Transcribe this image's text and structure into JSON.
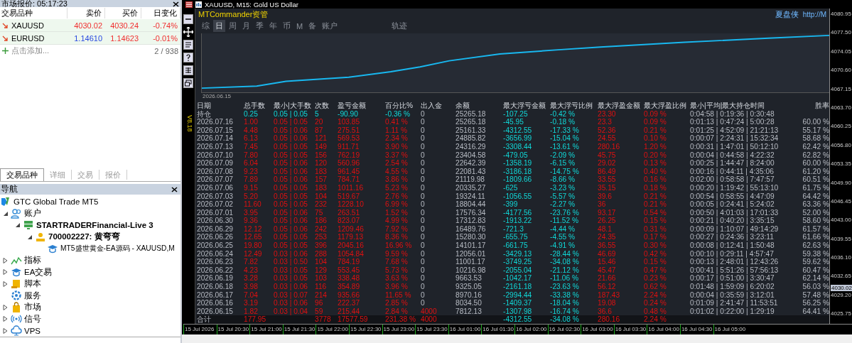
{
  "market_watch": {
    "title": "市场报价: 05:17:23",
    "columns": [
      "交易品种",
      "卖价",
      "买价",
      "日变化"
    ],
    "rows": [
      {
        "symbol": "XAUUSD",
        "bid": "4030.02",
        "ask": "4030.24",
        "change": "-0.74%",
        "color": "#f03030"
      },
      {
        "symbol": "EURUSD",
        "bid": "1.14610",
        "ask": "1.14623",
        "change": "-0.01%",
        "color": "#2848e0"
      }
    ],
    "add_label": "点击添加...",
    "count": "2 / 938"
  },
  "left_tabs": [
    {
      "label": "交易品种",
      "selected": true
    },
    {
      "label": "详细",
      "selected": false
    },
    {
      "label": "交易",
      "selected": false
    },
    {
      "label": "报价",
      "selected": false
    }
  ],
  "navigator": {
    "title": "导航",
    "tree": [
      {
        "label": "GTC Global Trade MT5",
        "kind": "broker",
        "children": [
          {
            "label": "账户",
            "kind": "accounts",
            "expanded": true,
            "children": [
              {
                "label": "STARTRADERFinancial-Live 3",
                "kind": "server",
                "expanded": true,
                "children": [
                  {
                    "label": "700002227: 黄弯弯",
                    "kind": "account",
                    "expanded": true,
                    "children": [
                      {
                        "label": "MT5盛世黄金-EA源码 - XAUUSD,M",
                        "kind": "expert"
                      }
                    ]
                  }
                ]
              }
            ]
          },
          {
            "label": "指标",
            "kind": "indicators",
            "expanded": false
          },
          {
            "label": "EA交易",
            "kind": "experts",
            "expanded": false
          },
          {
            "label": "脚本",
            "kind": "scripts",
            "expanded": false
          },
          {
            "label": "服务",
            "kind": "services"
          },
          {
            "label": "市场",
            "kind": "market",
            "expanded": false
          },
          {
            "label": "信号",
            "kind": "signals",
            "expanded": false
          },
          {
            "label": "VPS",
            "kind": "vps",
            "expanded": false
          }
        ]
      }
    ]
  },
  "chart": {
    "title": "XAUUSD, M15:  Gold US Dollar",
    "version": "V8.18",
    "panel": {
      "title": "MTCommander资管",
      "brand": "夏盘侠",
      "link": "http://M",
      "tabs": [
        {
          "label": "综",
          "selected": false
        },
        {
          "label": "日",
          "selected": true
        },
        {
          "label": "周",
          "selected": false
        },
        {
          "label": "月",
          "selected": false
        },
        {
          "label": "季",
          "selected": false
        },
        {
          "label": "年",
          "selected": false
        },
        {
          "label": "币",
          "selected": false
        },
        {
          "label": "M",
          "selected": false
        },
        {
          "label": "备",
          "selected": false
        },
        {
          "label": "账户",
          "selected": false
        },
        {
          "label": "轨迹",
          "selected": false
        }
      ],
      "equity_start": "2026.06.15",
      "table": {
        "columns": [
          "日期",
          "总手数",
          "最小|大手数",
          "次数",
          "盈亏金额",
          "百分比%",
          "出入金",
          "余额",
          "最大浮亏金额",
          "最大浮亏比例",
          "最大浮盈金额",
          "最大浮盈比例",
          "最小|平均|最大持仓时间",
          "胜率"
        ],
        "rows": [
          {
            "kind": "hold",
            "cells": [
              "持仓",
              "0.25",
              "0.05 | 0.05",
              "5",
              "-90.90",
              "-0.36 %",
              "0",
              "25265.18",
              "-107.25",
              "-0.42 %",
              "23.30",
              "0.09 %",
              "0:04:58 | 0:19:36 | 0:30:48",
              null
            ]
          },
          {
            "kind": "day",
            "cells": [
              "2026.07.16",
              "1.00",
              "0.05 | 0.05",
              "20",
              "103.85",
              "0.41 %",
              "0",
              "25265.18",
              "-45.95",
              "-0.18 %",
              "23.3",
              "0.09 %",
              "0:01:13 | 0:47:24 | 5:00:28",
              "60.00 %"
            ]
          },
          {
            "kind": "day",
            "cells": [
              "2026.07.15",
              "4.48",
              "0.05 | 0.06",
              "87",
              "275.51",
              "1.11 %",
              "0",
              "25161.33",
              "-4312.55",
              "-17.33 %",
              "52.36",
              "0.21 %",
              "0:01:25 | 4:52:09 | 21:21:13",
              "55.17 %"
            ]
          },
          {
            "kind": "day",
            "cells": [
              "2026.07.14",
              "6.13",
              "0.05 | 0.06",
              "121",
              "569.53",
              "2.34 %",
              "0",
              "24885.82",
              "-3656.99",
              "-15.04 %",
              "24.55",
              "0.10 %",
              "0:00:07 | 2:24:31 | 15:32:34",
              "58.68 %"
            ]
          },
          {
            "kind": "day",
            "cells": [
              "2026.07.13",
              "7.45",
              "0.05 | 0.05",
              "149",
              "911.71",
              "3.90 %",
              "0",
              "24316.29",
              "-3308.44",
              "-13.61 %",
              "280.16",
              "1.20 %",
              "0:00:31 | 1:47:01 | 50:12:10",
              "62.42 %"
            ]
          },
          {
            "kind": "day",
            "cells": [
              "2026.07.10",
              "7.80",
              "0.05 | 0.05",
              "156",
              "762.19",
              "3.37 %",
              "0",
              "23404.58",
              "-479.05",
              "-2.09 %",
              "45.75",
              "0.20 %",
              "0:00:04 | 0:44:58 | 4:22:32",
              "62.82 %"
            ]
          },
          {
            "kind": "day",
            "cells": [
              "2026.07.09",
              "6.04",
              "0.05 | 0.06",
              "120",
              "560.96",
              "2.54 %",
              "0",
              "22642.39",
              "-1358.19",
              "-6.15 %",
              "29.02",
              "0.13 %",
              "0:00:25 | 1:44:47 | 8:24:00",
              "60.00 %"
            ]
          },
          {
            "kind": "day",
            "cells": [
              "2026.07.08",
              "9.23",
              "0.05 | 0.06",
              "183",
              "961.45",
              "4.55 %",
              "0",
              "22081.43",
              "-3186.18",
              "-14.75 %",
              "86.49",
              "0.40 %",
              "0:00:16 | 0:44:11 | 4:35:06",
              "61.20 %"
            ]
          },
          {
            "kind": "day",
            "cells": [
              "2026.07.07",
              "7.89",
              "0.05 | 0.06",
              "157",
              "784.71",
              "3.86 %",
              "0",
              "21119.98",
              "-1809.66",
              "-8.66 %",
              "33.55",
              "0.16 %",
              "0:02:00 | 0:58:58 | 7:47:57",
              "60.51 %"
            ]
          },
          {
            "kind": "day",
            "cells": [
              "2026.07.06",
              "9.15",
              "0.05 | 0.05",
              "183",
              "1011.16",
              "5.23 %",
              "0",
              "20335.27",
              "-625",
              "-3.23 %",
              "35.15",
              "0.18 %",
              "0:00:20 | 1:19:42 | 55:13:10",
              "61.75 %"
            ]
          },
          {
            "kind": "day",
            "cells": [
              "2026.07.03",
              "5.20",
              "0.05 | 0.05",
              "104",
              "519.67",
              "2.76 %",
              "0",
              "19324.11",
              "-1056.55",
              "-5.57 %",
              "39.6",
              "0.21 %",
              "0:00:54 | 0:58:55 | 4:47:09",
              "64.42 %"
            ]
          },
          {
            "kind": "day",
            "cells": [
              "2026.07.02",
              "11.60",
              "0.05 | 0.05",
              "232",
              "1228.10",
              "6.99 %",
              "0",
              "18804.44",
              "-399",
              "-2.27 %",
              "36",
              "0.21 %",
              "0:00:05 | 0:24:41 | 5:24:02",
              "63.36 %"
            ]
          },
          {
            "kind": "day",
            "cells": [
              "2026.07.01",
              "3.95",
              "0.05 | 0.06",
              "75",
              "263.51",
              "1.52 %",
              "0",
              "17576.34",
              "-4177.56",
              "-23.76 %",
              "93.17",
              "0.54 %",
              "0:00:50 | 4:01:03 | 17:01:33",
              "52.00 %"
            ]
          },
          {
            "kind": "day",
            "cells": [
              "2026.06.30",
              "9.36",
              "0.05 | 0.06",
              "186",
              "823.07",
              "4.99 %",
              "0",
              "17312.83",
              "-1913.22",
              "-11.52 %",
              "26.25",
              "0.15 %",
              "0:00:21 | 0:40:20 | 3:35:15",
              "58.60 %"
            ]
          },
          {
            "kind": "day",
            "cells": [
              "2026.06.29",
              "12.12",
              "0.05 | 0.06",
              "242",
              "1209.46",
              "7.92 %",
              "0",
              "16489.76",
              "-721.3",
              "-4.44 %",
              "48.1",
              "0.31 %",
              "0:00:09 | 1:10:07 | 49:14:29",
              "61.57 %"
            ]
          },
          {
            "kind": "day",
            "cells": [
              "2026.06.26",
              "12.65",
              "0.05 | 0.05",
              "253",
              "1179.13",
              "8.36 %",
              "0",
              "15280.30",
              "-655.75",
              "-4.55 %",
              "24.35",
              "0.17 %",
              "0:00:27 | 0:24:36 | 3:23:11",
              "61.66 %"
            ]
          },
          {
            "kind": "day",
            "cells": [
              "2026.06.25",
              "19.80",
              "0.05 | 0.05",
              "396",
              "2045.16",
              "16.96 %",
              "0",
              "14101.17",
              "-661.75",
              "-4.91 %",
              "36.55",
              "0.30 %",
              "0:00:08 | 0:12:41 | 1:50:48",
              "62.63 %"
            ]
          },
          {
            "kind": "day",
            "cells": [
              "2026.06.24",
              "12.49",
              "0.03 | 0.06",
              "288",
              "1054.84",
              "9.59 %",
              "0",
              "12056.01",
              "-3429.13",
              "-28.44 %",
              "46.69",
              "0.42 %",
              "0:00:10 | 0:29:11 | 4:57:47",
              "59.38 %"
            ]
          },
          {
            "kind": "day",
            "cells": [
              "2026.06.23",
              "7.82",
              "0.03 | 0.50",
              "104",
              "784.19",
              "7.68 %",
              "0",
              "11001.17",
              "-3749.25",
              "-34.08 %",
              "15.46",
              "0.15 %",
              "0:00:13 | 2:48:01 | 12:43:26",
              "59.62 %"
            ]
          },
          {
            "kind": "day",
            "cells": [
              "2026.06.22",
              "4.23",
              "0.03 | 0.05",
              "129",
              "553.45",
              "5.73 %",
              "0",
              "10216.98",
              "-2055.04",
              "-21.12 %",
              "45.47",
              "0.47 %",
              "0:00:41 | 5:51:26 | 57:56:13",
              "60.47 %"
            ]
          },
          {
            "kind": "day",
            "cells": [
              "2026.06.19",
              "3.28",
              "0.03 | 0.05",
              "103",
              "338.48",
              "3.63 %",
              "0",
              "9663.53",
              "-1042.17",
              "-11.06 %",
              "21.66",
              "0.23 %",
              "0:00:17 | 0:51:00 | 3:30:47",
              "62.14 %"
            ]
          },
          {
            "kind": "day",
            "cells": [
              "2026.06.18",
              "3.98",
              "0.03 | 0.06",
              "116",
              "354.89",
              "3.96 %",
              "0",
              "9325.05",
              "-2161.18",
              "-23.63 %",
              "56.12",
              "0.62 %",
              "0:01:48 | 1:59:09 | 6:20:02",
              "56.03 %"
            ]
          },
          {
            "kind": "day",
            "cells": [
              "2026.06.17",
              "7.04",
              "0.03 | 0.07",
              "214",
              "935.66",
              "11.65 %",
              "0",
              "8970.16",
              "-2994.44",
              "-33.38 %",
              "187.43",
              "2.24 %",
              "0:00:04 | 0:35:59 | 3:12:01",
              "57.48 %"
            ]
          },
          {
            "kind": "day",
            "cells": [
              "2026.06.16",
              "3.19",
              "0.03 | 0.06",
              "96",
              "222.37",
              "2.85 %",
              "0",
              "8034.50",
              "-1409.37",
              "-18.04 %",
              "19.08",
              "0.24 %",
              "0:01:09 | 2:41:47 | 11:53:51",
              "56.25 %"
            ]
          },
          {
            "kind": "day",
            "cells": [
              "2026.06.15",
              "1.82",
              "0.03 | 0.04",
              "59",
              "215.44",
              "2.84 %",
              "4000",
              "7812.13",
              "-1307.98",
              "-16.74 %",
              "36.6",
              "0.48 %",
              "0:01:02 | 0:22:00 | 1:29:19",
              "64.41 %"
            ]
          },
          {
            "kind": "total",
            "cells": [
              "合计",
              "177.95",
              null,
              "3778",
              "17577.59",
              "231.38 %",
              "4000",
              null,
              "-4312.55",
              "-34.08 %",
              "280.16",
              "2.24 %",
              null,
              null
            ]
          }
        ]
      }
    },
    "price_axis": [
      {
        "label": "4080.95",
        "kind": "tick"
      },
      {
        "label": "4077.50",
        "kind": "tick"
      },
      {
        "label": "4074.05",
        "kind": "tick"
      },
      {
        "label": "4070.60",
        "kind": "tick"
      },
      {
        "label": "4067.15",
        "kind": "tick"
      },
      {
        "label": "4063.70",
        "kind": "tick"
      },
      {
        "label": "4060.25",
        "kind": "tick"
      },
      {
        "label": "4056.80",
        "kind": "tick"
      },
      {
        "label": "4053.35",
        "kind": "tick"
      },
      {
        "label": "4049.90",
        "kind": "tick"
      },
      {
        "label": "4046.45",
        "kind": "tick"
      },
      {
        "label": "4043.00",
        "kind": "tick"
      },
      {
        "label": "4039.55",
        "kind": "tick"
      },
      {
        "label": "4036.10",
        "kind": "tick"
      },
      {
        "label": "4032.65",
        "kind": "tick"
      },
      {
        "label": "4030.02",
        "kind": "current"
      },
      {
        "label": "4029.20",
        "kind": "tick"
      },
      {
        "label": "4025.75",
        "kind": "tick"
      }
    ],
    "time_axis": [
      "15 Jul 2026",
      "15 Jul 20:30",
      "15 Jul 21:00",
      "15 Jul 21:30",
      "15 Jul 22:00",
      "15 Jul 22:30",
      "15 Jul 23:00",
      "15 Jul 23:30",
      "16 Jul 01:00",
      "16 Jul 01:30",
      "16 Jul 02:00",
      "16 Jul 02:30",
      "16 Jul 03:00",
      "16 Jul 03:30",
      "16 Jul 04:00",
      "16 Jul 04:30",
      "16 Jul 05:00"
    ]
  }
}
